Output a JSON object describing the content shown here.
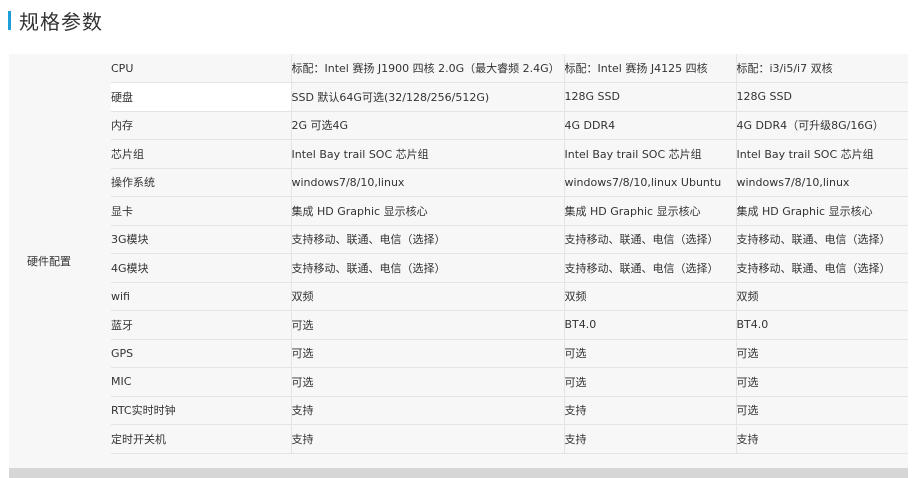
{
  "page": {
    "title": "规格参数",
    "accent_color": "#1e9fd9"
  },
  "spec": {
    "category": "硬件配置",
    "rows": [
      {
        "label": "CPU",
        "v1": "标配：Intel 赛扬 J1900 四核 2.0G（最大睿频 2.4G）",
        "v2": "标配：Intel 赛扬 J4125 四核",
        "v3": "标配：i3/i5/i7 双核"
      },
      {
        "label": "硬盘",
        "v1": "SSD 默认64G可选(32/128/256/512G)",
        "v2": "128G SSD",
        "v3": "128G SSD"
      },
      {
        "label": "内存",
        "v1": "2G 可选4G",
        "v2": "4G DDR4",
        "v3": "4G DDR4（可升级8G/16G）"
      },
      {
        "label": "芯片组",
        "v1": "Intel Bay trail SOC 芯片组",
        "v2": "Intel Bay trail SOC 芯片组",
        "v3": "Intel Bay trail SOC 芯片组"
      },
      {
        "label": "操作系统",
        "v1": "windows7/8/10,linux",
        "v2": "windows7/8/10,linux Ubuntu",
        "v3": "windows7/8/10,linux"
      },
      {
        "label": "显卡",
        "v1": "集成 HD Graphic 显示核心",
        "v2": "集成 HD Graphic 显示核心",
        "v3": "集成 HD Graphic 显示核心"
      },
      {
        "label": "3G模块",
        "v1": "支持移动、联通、电信（选择）",
        "v2": "支持移动、联通、电信（选择）",
        "v3": "支持移动、联通、电信（选择）"
      },
      {
        "label": "4G模块",
        "v1": "支持移动、联通、电信（选择）",
        "v2": "支持移动、联通、电信（选择）",
        "v3": "支持移动、联通、电信（选择）"
      },
      {
        "label": "wifi",
        "v1": "双频",
        "v2": "双频",
        "v3": "双频"
      },
      {
        "label": "蓝牙",
        "v1": "可选",
        "v2": "BT4.0",
        "v3": "BT4.0"
      },
      {
        "label": "GPS",
        "v1": "可选",
        "v2": "可选",
        "v3": "可选"
      },
      {
        "label": "MIC",
        "v1": "可选",
        "v2": "可选",
        "v3": "可选"
      },
      {
        "label": "RTC实时时钟",
        "v1": "支持",
        "v2": "支持",
        "v3": "可选"
      },
      {
        "label": "定时开关机",
        "v1": "支持",
        "v2": "支持",
        "v3": "支持"
      }
    ]
  }
}
